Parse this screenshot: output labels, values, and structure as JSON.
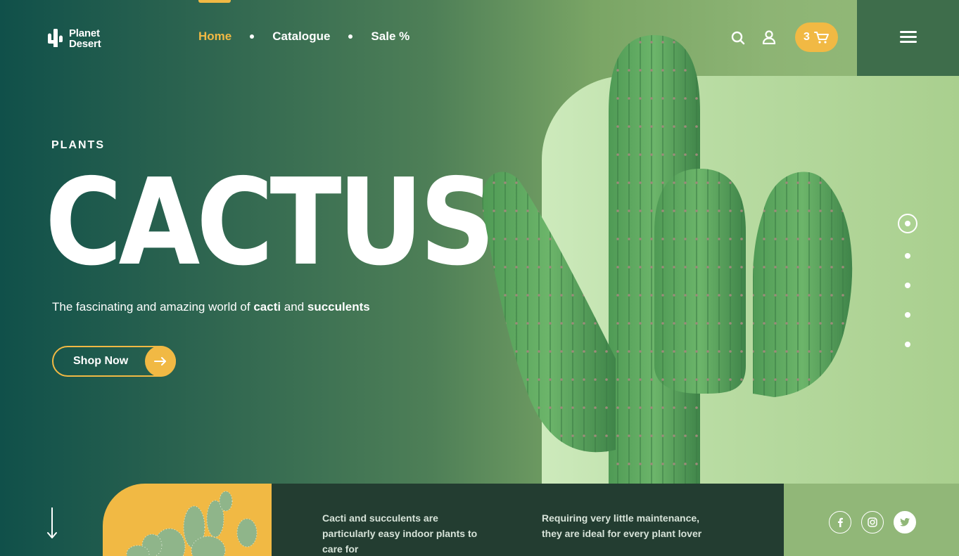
{
  "brand": {
    "line1": "Planet",
    "line2": "Desert"
  },
  "nav": [
    {
      "label": "Home",
      "active": true
    },
    {
      "label": "Catalogue",
      "active": false
    },
    {
      "label": "Sale %",
      "active": false
    }
  ],
  "cart": {
    "count": "3"
  },
  "hero": {
    "eyebrow": "PLANTS",
    "headline": "CACTUS",
    "tagline_prefix": "The fascinating and amazing world of ",
    "tagline_bold1": "cacti",
    "tagline_mid": " and ",
    "tagline_bold2": "succulents",
    "cta_label": "Shop Now"
  },
  "slider": {
    "total": 5,
    "active_index": 0
  },
  "footer": {
    "info1": "Cacti and succulents are particularly easy indoor plants to care for",
    "info2": "Requiring very little maintenance, they are ideal for every plant lover"
  },
  "icons": {
    "logo": "cactus-icon",
    "search": "search-icon",
    "user": "user-icon",
    "cart": "cart-icon",
    "menu": "hamburger-icon",
    "cta": "arrow-right-icon",
    "scroll": "arrow-down-icon",
    "social": [
      "facebook-icon",
      "instagram-icon",
      "twitter-icon"
    ]
  },
  "colors": {
    "accent": "#f1b944",
    "dark_green": "#10504a",
    "panel_green": "#cdeabc",
    "info_band": "#233d31"
  }
}
